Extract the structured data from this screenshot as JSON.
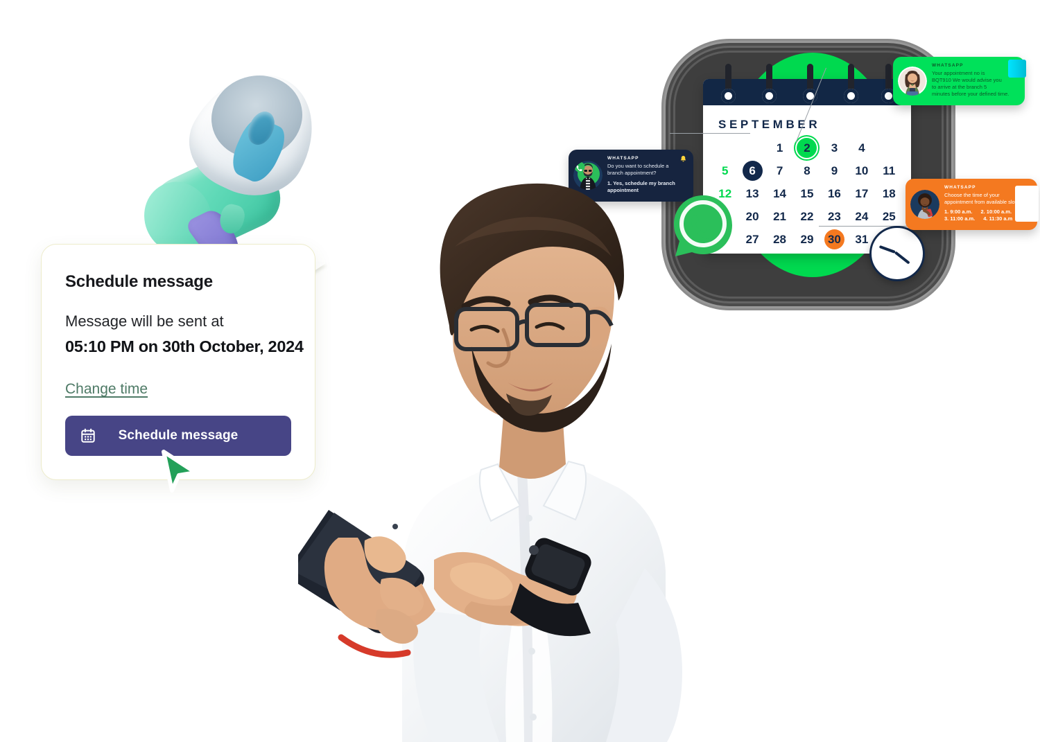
{
  "page": {
    "title": "WhatsApp appointment scheduling hero illustration",
    "background_color": "#ffffff"
  },
  "colors": {
    "brand_purple": "#474586",
    "whatsapp_green": "#00d94f",
    "navy": "#12284a",
    "orange": "#f47920",
    "link_green": "#4e7a66",
    "cursor_green": "#23a059",
    "card_border": "#edeccb"
  },
  "schedule_card": {
    "title": "Schedule message",
    "subtitle": "Message will be sent at",
    "datetime": "05:10 PM on 30th October, 2024",
    "change_time_link": "Change time",
    "button_label": "Schedule message",
    "button_icon": "calendar-icon"
  },
  "megaphone": {
    "icon_name": "megaphone-3d-illustration"
  },
  "cursor": {
    "icon_name": "cursor-arrow-icon"
  },
  "calendar": {
    "month": "SEPTEMBER",
    "weeks": [
      [
        "",
        "",
        "1",
        "2",
        "3",
        "4",
        ""
      ],
      [
        "5",
        "6",
        "7",
        "8",
        "9",
        "10",
        "11"
      ],
      [
        "12",
        "13",
        "14",
        "15",
        "16",
        "17",
        "18"
      ],
      [
        "",
        "20",
        "21",
        "22",
        "23",
        "24",
        "25"
      ],
      [
        "",
        "27",
        "28",
        "29",
        "30",
        "31",
        ""
      ]
    ],
    "highlighted": {
      "green_circle_day": "2",
      "navy_circle_day": "6",
      "orange_circle_day": "30",
      "green_text_days": [
        "5",
        "12"
      ]
    },
    "clock_icon": "clock-icon",
    "whatsapp_icon": "whatsapp-logo-icon",
    "ring_count": 5
  },
  "chat_cards": [
    {
      "id": "navy",
      "tag": "WHATSAPP",
      "avatar": "bearded-man-avatar",
      "badge_icon": "bell-icon",
      "lines": [
        {
          "text": "Do you want to schedule a",
          "bold": false
        },
        {
          "text": "branch appointment?",
          "bold": false
        },
        {
          "text": "1. Yes, schedule my branch",
          "bold": true
        },
        {
          "text": "appointment",
          "bold": true
        }
      ],
      "slots": []
    },
    {
      "id": "green",
      "tag": "WHATSAPP",
      "avatar": "smiling-woman-avatar",
      "badge_icon": "",
      "lines": [
        {
          "text": "Your appointment no is",
          "bold": false
        },
        {
          "text": "BQT910",
          "bold": true
        },
        {
          "text": "We would advise you",
          "bold": false
        },
        {
          "text": "to arrive at the branch 5",
          "bold": false
        },
        {
          "text": "minutes before your defined",
          "bold": true
        },
        {
          "text": "time.",
          "bold": false
        }
      ],
      "slots": []
    },
    {
      "id": "orange",
      "tag": "WHATSAPP",
      "avatar": "woman-with-phone-avatar",
      "badge_icon": "",
      "lines": [
        {
          "text": "Choose the time of your",
          "bold": false
        },
        {
          "text": "appointment from available slots:",
          "bold": false
        }
      ],
      "slots": [
        "1.  9:00 a.m.",
        "2. 10:00 a.m.",
        "3. 11:00 a.m.",
        "4. 11:30 a.m"
      ]
    }
  ],
  "person": {
    "description": "man-with-glasses-using-phone",
    "shirt": "white shirt",
    "accessories": [
      "black-smartwatch",
      "red-thread-bracelet",
      "eyeglasses",
      "smartphone"
    ]
  }
}
